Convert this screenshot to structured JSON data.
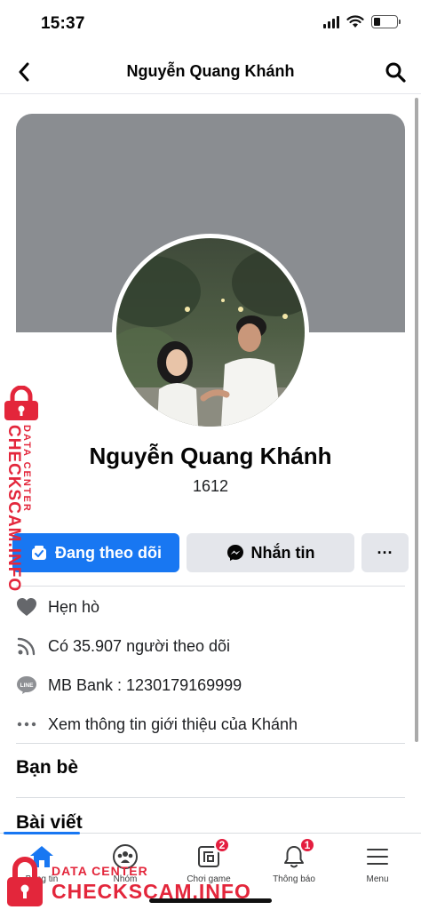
{
  "status_bar": {
    "time": "15:37",
    "battery_level": 0.3
  },
  "nav": {
    "title": "Nguyễn Quang Khánh",
    "back_icon": "chevron-left-icon",
    "search_icon": "search-icon"
  },
  "profile": {
    "name": "Nguyễn Quang Khánh",
    "subtitle": "1612"
  },
  "actions": {
    "follow_label": "Đang theo dõi",
    "message_label": "Nhắn tin",
    "more_label": "···"
  },
  "info_rows": [
    {
      "icon": "heart-icon",
      "text": "Hẹn hò"
    },
    {
      "icon": "rss-icon",
      "text": "Có 35.907 người theo dõi"
    },
    {
      "icon": "line-icon",
      "text": "MB Bank : 1230179169999"
    },
    {
      "icon": "more-dots-icon",
      "text": "Xem thông tin giới thiệu của Khánh"
    }
  ],
  "sections": {
    "friends": "Bạn bè",
    "posts": "Bài viết"
  },
  "tab_bar": {
    "tabs": [
      {
        "label": "Bảng tin",
        "icon": "home-icon",
        "active": true
      },
      {
        "label": "Nhóm",
        "icon": "groups-icon"
      },
      {
        "label": "Chơi game",
        "icon": "gaming-icon",
        "badge": "2"
      },
      {
        "label": "Thông báo",
        "icon": "bell-icon",
        "badge": "1"
      },
      {
        "label": "Menu",
        "icon": "hamburger-menu-icon"
      }
    ]
  },
  "watermark": {
    "small": "DATA CENTER",
    "big": "CHECKSCAM.INFO"
  },
  "colors": {
    "accent": "#1877f2",
    "badge": "#e41e3f",
    "watermark": "#e3263b",
    "cover": "#8a8d91"
  }
}
